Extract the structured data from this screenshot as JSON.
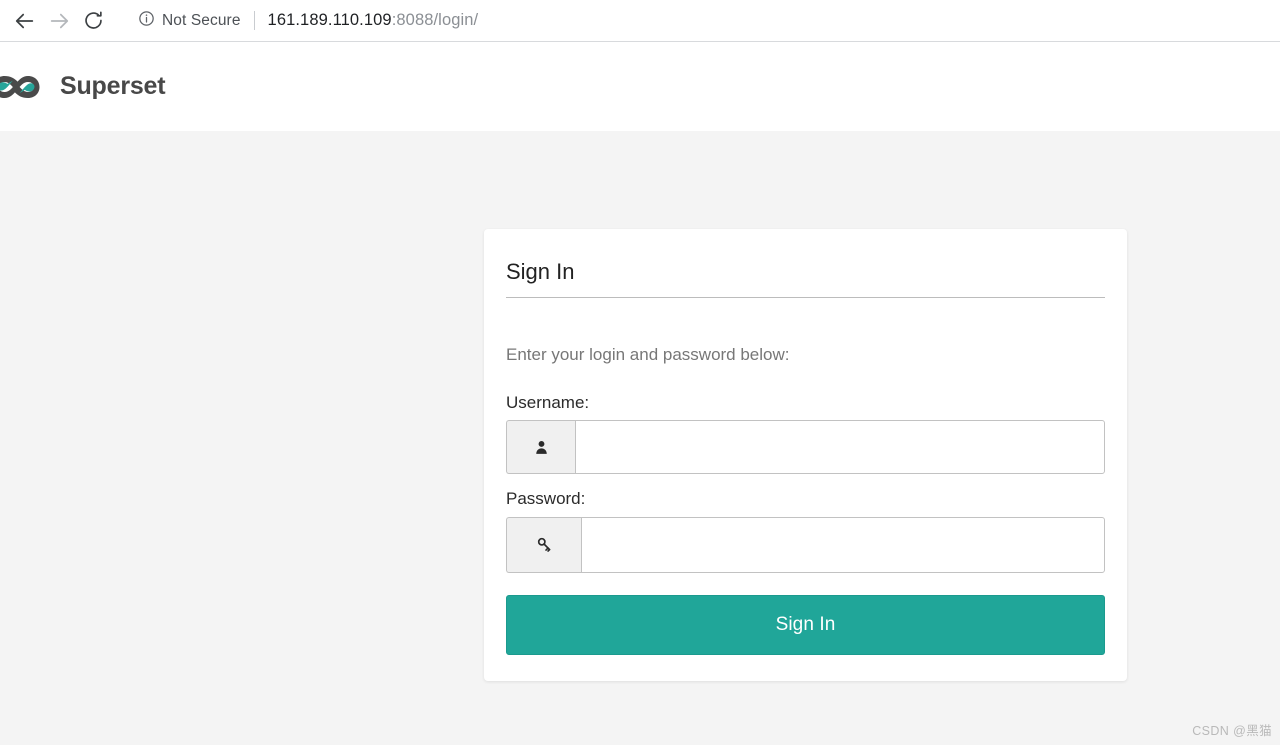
{
  "browser": {
    "back_icon": "back-arrow-icon",
    "forward_icon": "forward-arrow-icon",
    "reload_icon": "reload-icon",
    "security_icon": "info-circle-icon",
    "security_label": "Not Secure",
    "url_host": "161.189.110.109",
    "url_rest": ":8088/login/",
    "url_full": "161.189.110.109:8088/login/"
  },
  "navbar": {
    "logo_icon": "superset-infinity-logo-icon",
    "brand": "Superset"
  },
  "login": {
    "panel_title": "Sign In",
    "intro": "Enter your login and password below:",
    "username": {
      "label": "Username:",
      "icon": "user-icon",
      "value": "",
      "placeholder": ""
    },
    "password": {
      "label": "Password:",
      "icon": "key-icon",
      "value": "",
      "placeholder": ""
    },
    "submit_label": "Sign In"
  },
  "watermark": "CSDN @黑猫",
  "colors": {
    "accent_teal": "#20a699",
    "logo_teal": "#27a59a",
    "logo_dark": "#4a4a4a",
    "page_background": "#f4f4f4",
    "card_background": "#ffffff"
  }
}
